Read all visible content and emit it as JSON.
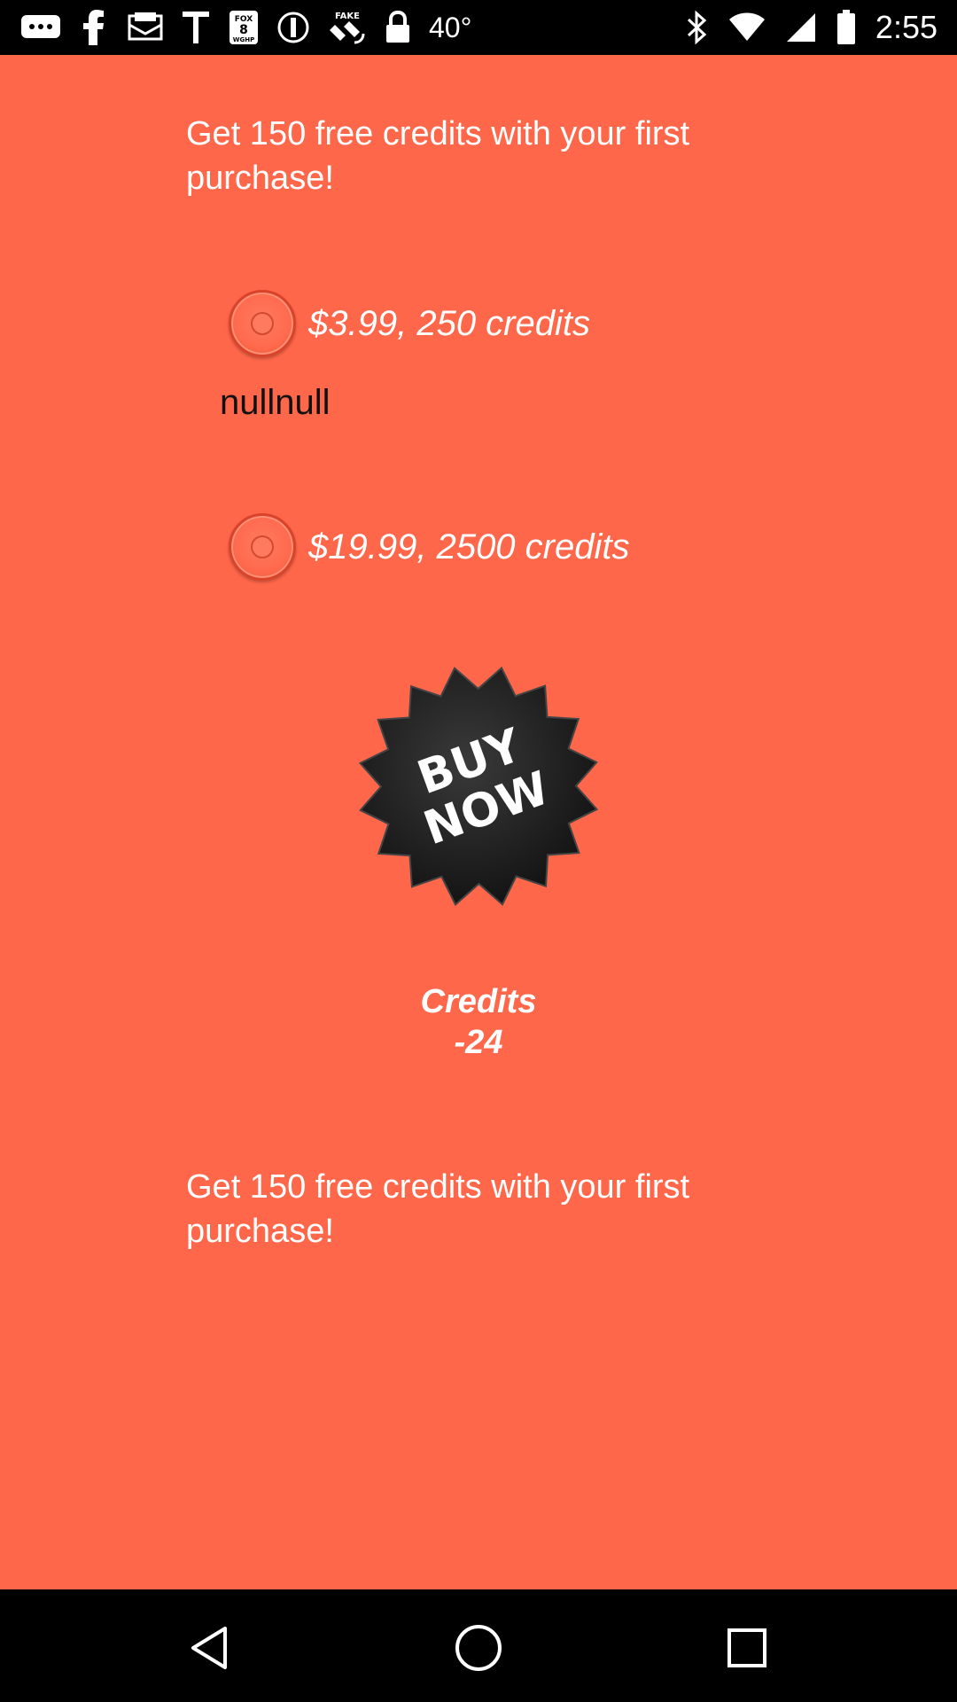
{
  "status_bar": {
    "icons_left": [
      "messages-icon",
      "facebook-icon",
      "email-icon",
      "text-t-icon",
      "fox8-icon",
      "notification-circle-icon",
      "fake-gps-icon",
      "lock-icon"
    ],
    "temperature": "40°",
    "icons_right": [
      "bluetooth-icon",
      "wifi-icon",
      "signal-icon",
      "battery-icon"
    ],
    "time": "2:55",
    "fox_badge_line1": "FOX",
    "fox_badge_line2": "8",
    "fox_badge_line3": "WGHP",
    "fake_badge": "FAKE"
  },
  "main": {
    "promo_top": "Get 150 free credits with your first purchase!",
    "options": [
      {
        "label": "$3.99, 250 credits",
        "selected": false
      },
      {
        "label": "$19.99, 2500 credits",
        "selected": false
      }
    ],
    "note": "nullnull",
    "buy_now_line1": "BUY",
    "buy_now_line2": "NOW",
    "credits_label": "Credits",
    "credits_value": "-24",
    "promo_bottom": "Get 150 free credits with your first purchase!"
  },
  "colors": {
    "background": "#ff674a",
    "text": "#ffffff",
    "note_text": "#111111",
    "badge": "#222222"
  },
  "nav_bar": {
    "buttons": [
      "back-icon",
      "home-icon",
      "recents-icon"
    ]
  }
}
